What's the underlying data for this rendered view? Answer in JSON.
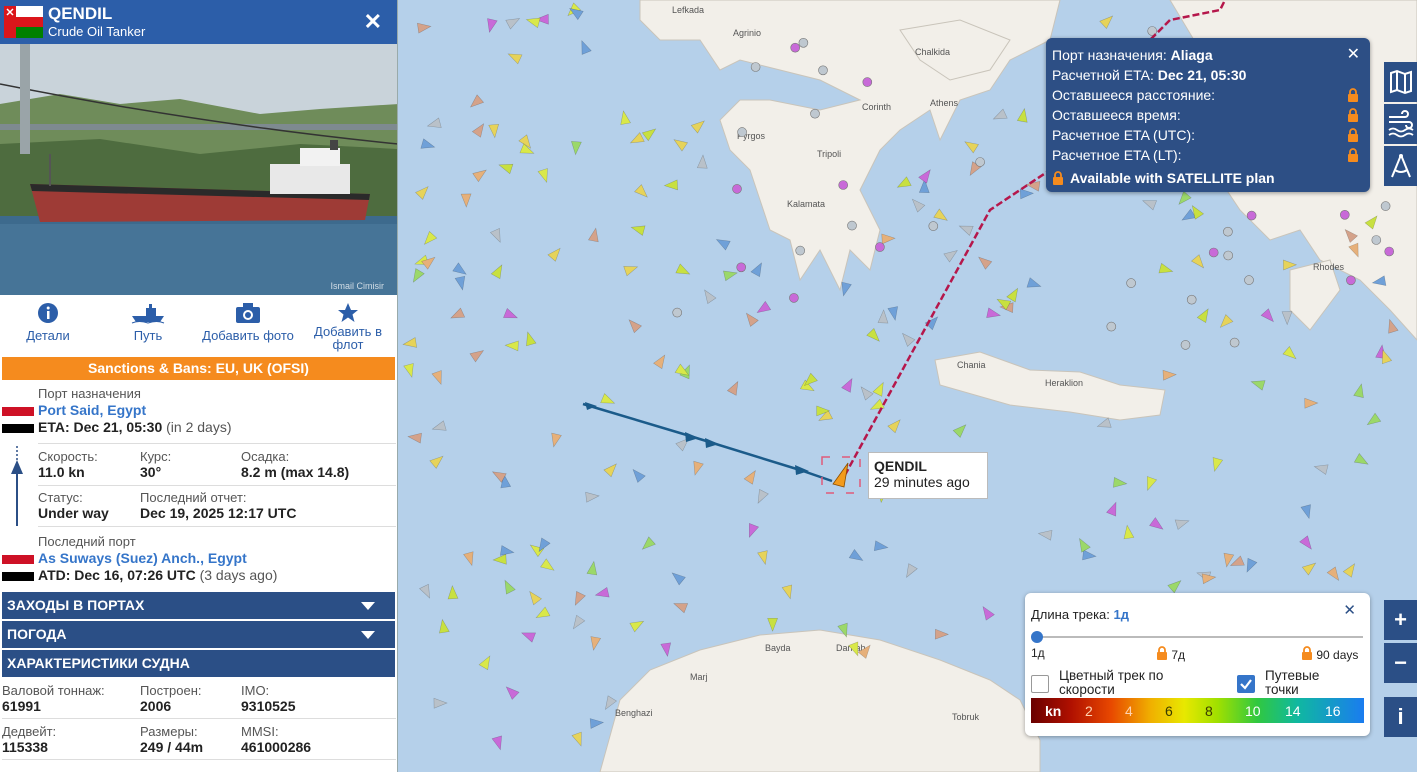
{
  "vessel": {
    "name": "QENDIL",
    "type": "Crude Oil Tanker",
    "photo_credit": "Ismail Cimisir",
    "actions": {
      "details": "Детали",
      "route": "Путь",
      "add_photo": "Добавить фото",
      "add_fleet_1": "Добавить в",
      "add_fleet_2": "флот"
    },
    "sanctions": "Sanctions & Bans: EU, UK (OFSI)",
    "destination": {
      "label": "Порт назначения",
      "port": "Port Said, Egypt",
      "eta": "ETA: Dec 21, 05:30",
      "eta_rel": "(in 2 days)"
    },
    "speed": {
      "label": "Скорость:",
      "value": "11.0 kn"
    },
    "course": {
      "label": "Курс:",
      "value": "30°"
    },
    "draught": {
      "label": "Осадка:",
      "value": "8.2 m (max 14.8)"
    },
    "status": {
      "label": "Статус:",
      "value": "Under way"
    },
    "last_report": {
      "label": "Последний отчет:",
      "value": "Dec 19, 2025 12:17 UTC"
    },
    "last_port": {
      "label": "Последний порт",
      "port": "As Suways (Suez) Anch., Egypt",
      "atd": "ATD: Dec 16, 07:26 UTC",
      "atd_rel": "(3 days ago)"
    },
    "sections": [
      "ЗАХОДЫ В ПОРТАХ",
      "ПОГОДА",
      "ХАРАКТЕРИСТИКИ СУДНА"
    ],
    "specs": {
      "gt": {
        "label": "Валовой тоннаж:",
        "value": "61991"
      },
      "built": {
        "label": "Построен:",
        "value": "2006"
      },
      "imo": {
        "label": "IMO:",
        "value": "9310525"
      },
      "dwt": {
        "label": "Дедвейт:",
        "value": "115338"
      },
      "dims": {
        "label": "Размеры:",
        "value": "249 / 44m"
      },
      "mmsi": {
        "label": "MMSI:",
        "value": "461000286"
      }
    }
  },
  "port_popup": {
    "dest_label": "Порт назначения:",
    "dest_value": "Aliaga",
    "eta_label": "Расчетной ETA:",
    "eta_value": "Dec 21, 05:30",
    "remaining_distance": "Оставшееся расстояние:",
    "remaining_time": "Оставшееся время:",
    "eta_utc": "Расчетное ETA (UTC):",
    "eta_lt": "Расчетное ETA (LT):",
    "satellite": "Available with SATELLITE plan"
  },
  "ship_tip": {
    "name": "QENDIL",
    "age": "29 minutes ago"
  },
  "track_panel": {
    "title": "Длина трека:",
    "value": "1д",
    "ticks": [
      "1д",
      "7д",
      "90 days"
    ],
    "slider_fraction": 0,
    "color_by_speed_1": "Цветный трек по",
    "color_by_speed_2": "скорости",
    "color_by_speed_checked": false,
    "waypoints_1": "Путевые",
    "waypoints_2": "точки",
    "waypoints_checked": true,
    "legend": [
      "kn",
      "2",
      "4",
      "6",
      "8",
      "10",
      "14",
      "16"
    ]
  },
  "map_labels": [
    "Lefkada",
    "Agrinio",
    "Chalkida",
    "Corinth",
    "Athens",
    "Pyrgos",
    "Tripoli",
    "Kalamata",
    "Chania",
    "Heraklion",
    "Rhodes",
    "Bayda",
    "Darnah",
    "Marj",
    "Benghazi",
    "Tobruk"
  ],
  "map_controls": {
    "zoom_in": "+",
    "zoom_out": "−",
    "info": "i"
  },
  "colors": {
    "header": "#2c5ea9",
    "bar": "#2b4f86",
    "sanctions": "#f58b1e",
    "sea": "#b5d0ea",
    "land": "#f2efe9",
    "route": "#b5174b",
    "track": "#1b5b8a"
  }
}
